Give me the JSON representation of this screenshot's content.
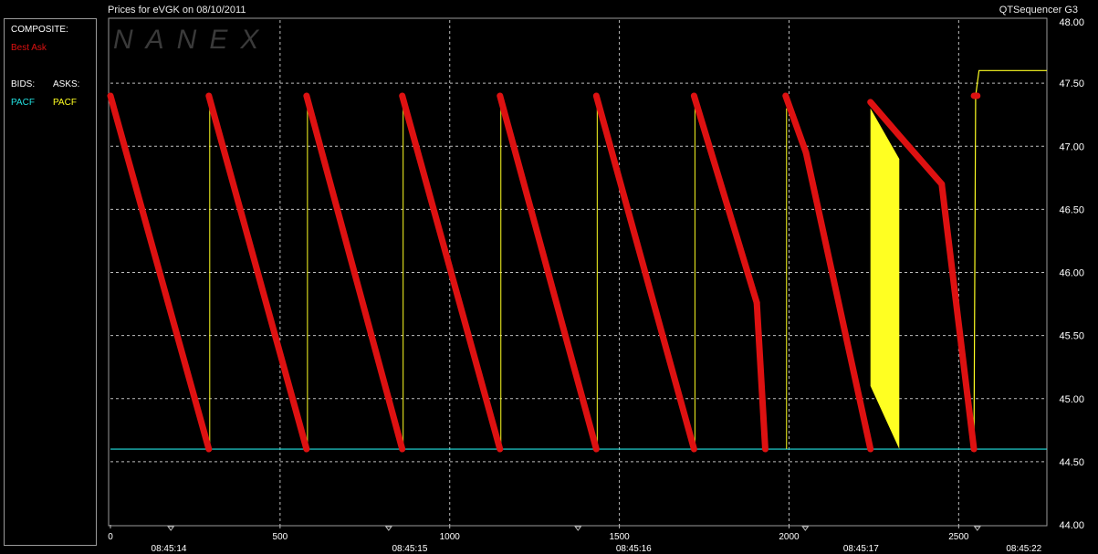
{
  "header": {
    "title": "Prices for  eVGK  on  08/10/2011",
    "app_name": "QTSequencer G3"
  },
  "watermark": "NANEX",
  "legend": {
    "composite_label": "COMPOSITE:",
    "composite_item": "Best Ask",
    "bids_label": "BIDS:",
    "asks_label": "ASKS:",
    "bid_exchange": "PACF",
    "ask_exchange": "PACF",
    "colors": {
      "best_ask": "#dd1111",
      "bid": "#22e0e0",
      "ask": "#ffff22",
      "label": "#ffffff"
    }
  },
  "chart_data": {
    "type": "line",
    "x_range": [
      0,
      2760
    ],
    "ylim": [
      44.0,
      48.0
    ],
    "y_ticks": [
      "44.00",
      "44.50",
      "45.00",
      "45.50",
      "46.00",
      "46.50",
      "47.00",
      "47.50",
      "48.00"
    ],
    "x_ticks": [
      "0",
      "500",
      "1000",
      "1500",
      "2000",
      "2500"
    ],
    "time_ticks": [
      {
        "x": 0,
        "label": "08:45:14"
      },
      {
        "x": 710,
        "label": "08:45:15"
      },
      {
        "x": 1370,
        "label": "08:45:16"
      },
      {
        "x": 2040,
        "label": "08:45:17"
      },
      {
        "x": 2520,
        "label": "08:45:22"
      }
    ],
    "time_marker_x": [
      178,
      820,
      1378,
      2048,
      2555
    ],
    "grid": true,
    "series": [
      {
        "name": "Best Ask",
        "color": "#dd1111",
        "style": "dots",
        "segments": [
          [
            [
              0,
              47.4
            ],
            [
              290,
              44.6
            ]
          ],
          [
            [
              290,
              47.4
            ],
            [
              578,
              44.6
            ]
          ],
          [
            [
              578,
              47.4
            ],
            [
              860,
              44.6
            ]
          ],
          [
            [
              860,
              47.4
            ],
            [
              1148,
              44.6
            ]
          ],
          [
            [
              1148,
              47.4
            ],
            [
              1432,
              44.6
            ]
          ],
          [
            [
              1432,
              47.4
            ],
            [
              1720,
              44.6
            ]
          ],
          [
            [
              1720,
              47.4
            ],
            [
              1905,
              45.76
            ],
            [
              1930,
              44.6
            ]
          ],
          [
            [
              1990,
              47.4
            ],
            [
              2050,
              46.95
            ],
            [
              2240,
              44.6
            ]
          ],
          [
            [
              2240,
              47.35
            ],
            [
              2320,
              47.1
            ],
            [
              2450,
              46.7
            ],
            [
              2545,
              44.6
            ]
          ],
          [
            [
              2545,
              47.4
            ],
            [
              2555,
              47.4
            ]
          ]
        ]
      },
      {
        "name": "PACF",
        "role": "bid",
        "color": "#22e0e0",
        "points": [
          [
            0,
            44.6
          ],
          [
            2760,
            44.6
          ]
        ]
      },
      {
        "name": "PACF",
        "role": "ask",
        "color": "#ffff22",
        "spikes_x": [
          290,
          578,
          860,
          1148,
          1432,
          1720,
          1990
        ],
        "spike_low": 44.6,
        "spike_high": 47.3,
        "band": {
          "x_start": 2240,
          "x_end": 2325,
          "low_start": 45.1,
          "low_end": 44.6,
          "high": 47.3
        },
        "final": [
          [
            2545,
            44.6
          ],
          [
            2550,
            47.4
          ],
          [
            2560,
            47.6
          ],
          [
            2760,
            47.6
          ]
        ]
      }
    ]
  }
}
